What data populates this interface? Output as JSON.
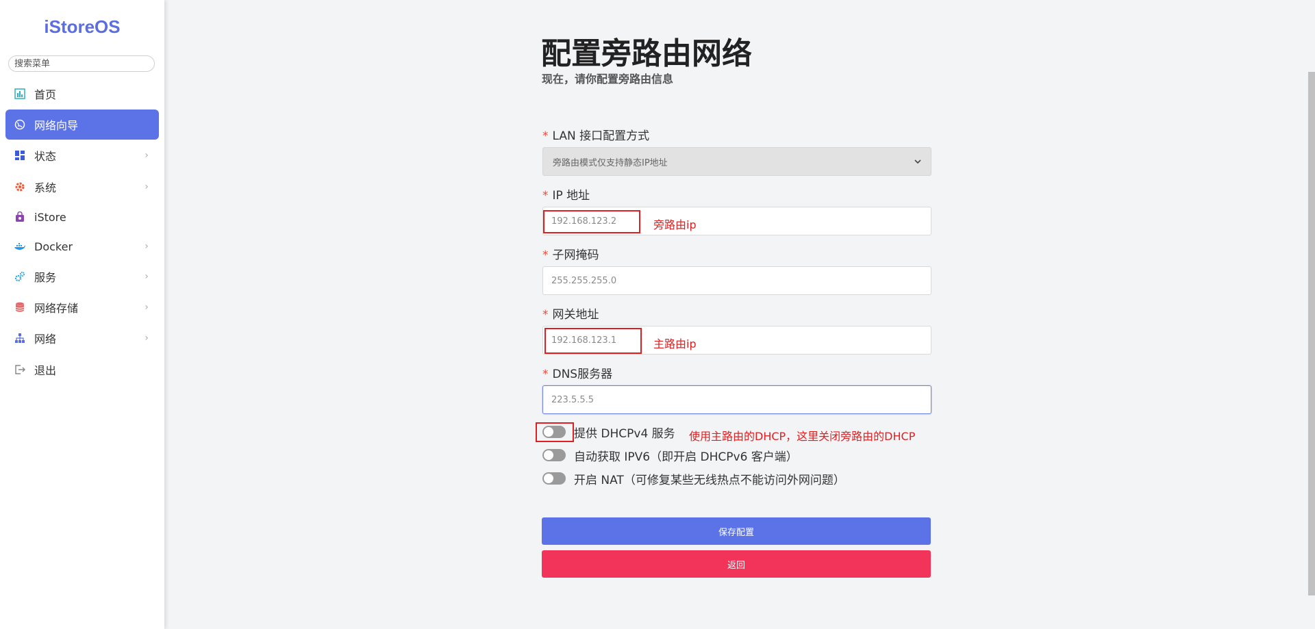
{
  "app": {
    "logo": "iStoreOS"
  },
  "sidebar": {
    "search_placeholder": "搜索菜单",
    "items": [
      {
        "label": "首页",
        "icon": "dashboard-icon",
        "color": "#29b0c9",
        "expandable": false,
        "active": false
      },
      {
        "label": "网络向导",
        "icon": "globe-icon",
        "color": "#ffffff",
        "expandable": false,
        "active": true
      },
      {
        "label": "状态",
        "icon": "grid-icon",
        "color": "#3b5bdb",
        "expandable": true,
        "active": false
      },
      {
        "label": "系统",
        "icon": "gear-icon",
        "color": "#f25a38",
        "expandable": true,
        "active": false
      },
      {
        "label": "iStore",
        "icon": "store-bag-icon",
        "color": "#8e44ad",
        "expandable": false,
        "active": false
      },
      {
        "label": "Docker",
        "icon": "docker-whale-icon",
        "color": "#2496ed",
        "expandable": true,
        "active": false
      },
      {
        "label": "服务",
        "icon": "cogs-icon",
        "color": "#27a3d9",
        "expandable": true,
        "active": false
      },
      {
        "label": "网络存储",
        "icon": "database-icon",
        "color": "#e26a6a",
        "expandable": true,
        "active": false
      },
      {
        "label": "网络",
        "icon": "network-tree-icon",
        "color": "#5b6ee1",
        "expandable": true,
        "active": false
      },
      {
        "label": "退出",
        "icon": "logout-icon",
        "color": "#888888",
        "expandable": false,
        "active": false
      }
    ]
  },
  "page": {
    "title": "配置旁路由网络",
    "subtitle": "现在，请你配置旁路由信息"
  },
  "form": {
    "required_mark": "*",
    "lan_mode": {
      "label": "LAN 接口配置方式",
      "value": "旁路由模式仅支持静态IP地址"
    },
    "ip": {
      "label": "IP 地址",
      "placeholder": "192.168.123.2"
    },
    "netmask": {
      "label": "子网掩码",
      "placeholder": "255.255.255.0"
    },
    "gateway": {
      "label": "网关地址",
      "placeholder": "192.168.123.1"
    },
    "dns": {
      "label": "DNS服务器",
      "placeholder": "223.5.5.5"
    },
    "toggles": [
      {
        "label": "提供 DHCPv4 服务",
        "on": false
      },
      {
        "label": "自动获取 IPV6（即开启 DHCPv6 客户端）",
        "on": false
      },
      {
        "label": "开启 NAT（可修复某些无线热点不能访问外网问题）",
        "on": false
      }
    ],
    "save_label": "保存配置",
    "back_label": "返回"
  },
  "annotations": {
    "ip_note": "旁路由ip",
    "gateway_note": "主路由ip",
    "dhcp_note": "使用主路由的DHCP，这里关闭旁路由的DHCP"
  },
  "colors": {
    "accent": "#5c73e7",
    "danger": "#f2345a",
    "annotation": "#e02020"
  }
}
